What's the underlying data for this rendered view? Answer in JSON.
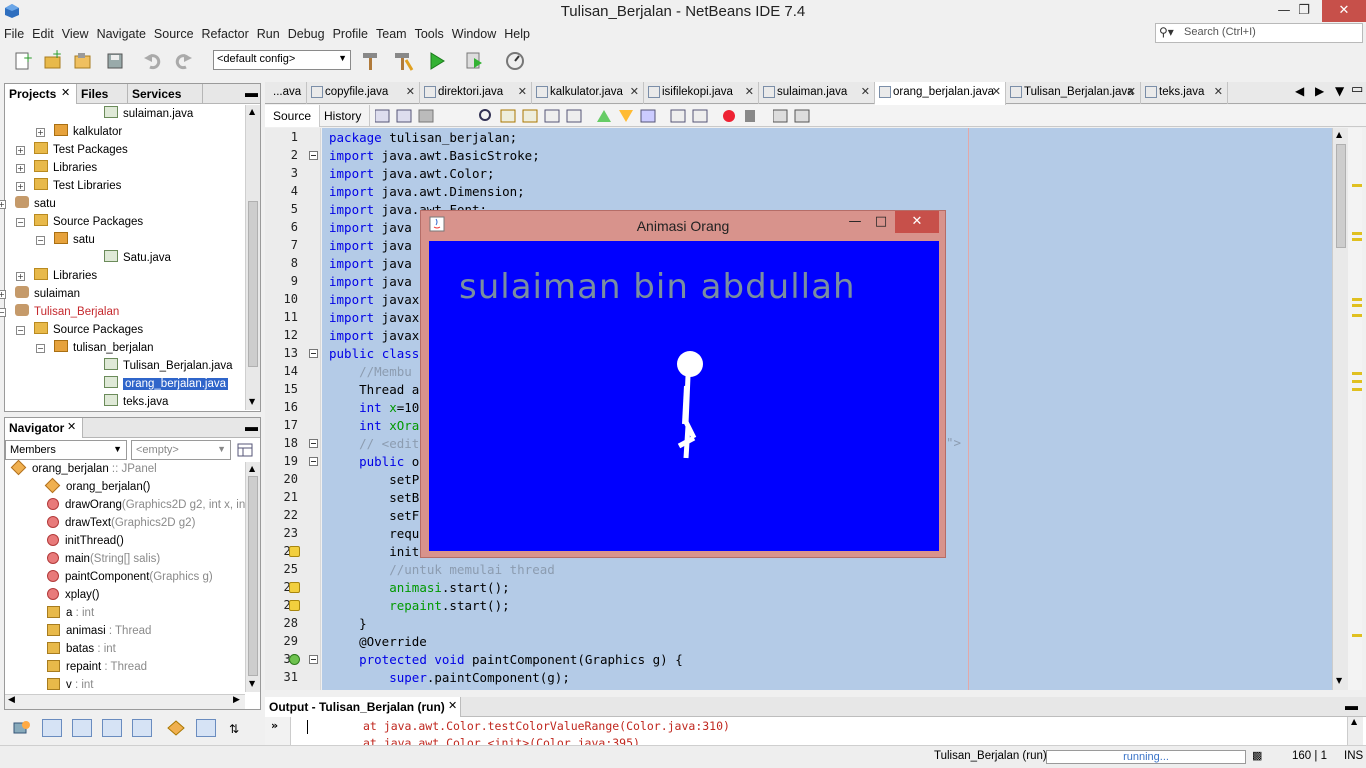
{
  "window": {
    "title": "Tulisan_Berjalan - NetBeans IDE 7.4"
  },
  "menu": [
    "File",
    "Edit",
    "View",
    "Navigate",
    "Source",
    "Refactor",
    "Run",
    "Debug",
    "Profile",
    "Team",
    "Tools",
    "Window",
    "Help"
  ],
  "search": {
    "placeholder": "Search (Ctrl+I)"
  },
  "toolbar": {
    "config": "<default config>"
  },
  "projects_panel": {
    "tabs": [
      "Projects",
      "Files",
      "Services"
    ],
    "tree": [
      {
        "label": "sulaiman.java",
        "type": "file"
      },
      {
        "label": "kalkulator",
        "type": "package"
      },
      {
        "label": "Test Packages",
        "type": "folder"
      },
      {
        "label": "Libraries",
        "type": "folder"
      },
      {
        "label": "Test Libraries",
        "type": "folder"
      },
      {
        "label": "satu",
        "type": "project"
      },
      {
        "label": "Source Packages",
        "type": "folder"
      },
      {
        "label": "satu",
        "type": "package"
      },
      {
        "label": "Satu.java",
        "type": "file"
      },
      {
        "label": "Libraries",
        "type": "folder"
      },
      {
        "label": "sulaiman",
        "type": "project"
      },
      {
        "label": "Tulisan_Berjalan",
        "type": "project"
      },
      {
        "label": "Source Packages",
        "type": "folder"
      },
      {
        "label": "tulisan_berjalan",
        "type": "package"
      },
      {
        "label": "Tulisan_Berjalan.java",
        "type": "file"
      },
      {
        "label": "orang_berjalan.java",
        "type": "file"
      },
      {
        "label": "teks.java",
        "type": "file"
      }
    ]
  },
  "navigator": {
    "title": "Navigator",
    "filter": "Members",
    "empty": "<empty>",
    "root": {
      "name": "orang_berjalan",
      "type": ":: JPanel"
    },
    "members": [
      {
        "name": "orang_berjalan()",
        "sig": "",
        "kind": "constructor"
      },
      {
        "name": "drawOrang",
        "sig": "(Graphics2D g2, int x, int",
        "kind": "method"
      },
      {
        "name": "drawText",
        "sig": "(Graphics2D g2)",
        "kind": "method"
      },
      {
        "name": "initThread()",
        "sig": "",
        "kind": "method"
      },
      {
        "name": "main",
        "sig": "(String[] salis)",
        "kind": "method"
      },
      {
        "name": "paintComponent",
        "sig": "(Graphics g)",
        "kind": "method"
      },
      {
        "name": "xplay()",
        "sig": "",
        "kind": "method"
      },
      {
        "name": "a",
        "sig": " : int",
        "kind": "field"
      },
      {
        "name": "animasi",
        "sig": " : Thread",
        "kind": "field"
      },
      {
        "name": "batas",
        "sig": " : int",
        "kind": "field"
      },
      {
        "name": "repaint",
        "sig": " : Thread",
        "kind": "field"
      },
      {
        "name": "v",
        "sig": " : int",
        "kind": "field"
      }
    ]
  },
  "editor_tabs": [
    "...ava",
    "copyfile.java",
    "direktori.java",
    "kalkulator.java",
    "isifilekopi.java",
    "sulaiman.java",
    "orang_berjalan.java",
    "Tulisan_Berjalan.java",
    "teks.java"
  ],
  "editor": {
    "source_label": "Source",
    "history_label": "History",
    "lines": [
      "package tulisan_berjalan;",
      "import java.awt.BasicStroke;",
      "import java.awt.Color;",
      "import java.awt.Dimension;",
      "import java.awt.Font;",
      "import java",
      "import java",
      "import java",
      "import java",
      "import javax",
      "import javax",
      "import javax",
      "public class",
      "    //Membu",
      "    Thread a",
      "    int x=10",
      "    int xOra",
      "    // <edit",
      "    public o",
      "        setP",
      "        setB",
      "        setF",
      "        requ",
      "        init",
      "        //untuk memulai thread",
      "        animasi.start();",
      "        repaint.start();",
      "    }",
      "    @Override",
      "    protected void paintComponent(Graphics g) {",
      "        super.paintComponent(g);"
    ],
    "fold_tail": "\">"
  },
  "animation_window": {
    "title": "Animasi Orang",
    "canvas_text": "sulaiman bin abdullah",
    "canvas_color": "#0000ff"
  },
  "output": {
    "title": "Output - Tulisan_Berjalan (run)",
    "lines": [
      "at java.awt.Color.testColorValueRange(Color.java:310)",
      "at java.awt.Color.<init>(Color.java:395)"
    ]
  },
  "status": {
    "project": "Tulisan_Berjalan (run)",
    "progress": "running...",
    "position": "160 | 1",
    "mode": "INS"
  }
}
